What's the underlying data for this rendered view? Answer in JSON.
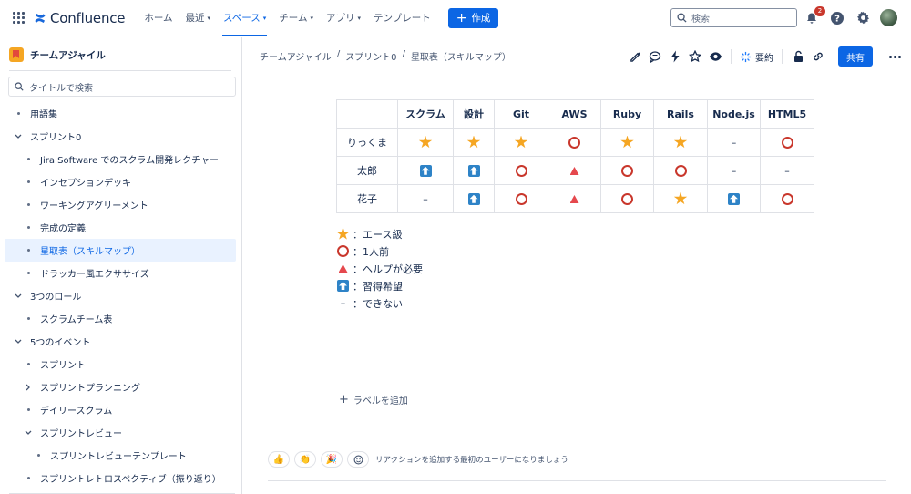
{
  "topnav": {
    "brand": "Confluence",
    "items": [
      {
        "label": "ホーム",
        "dropdown": false,
        "active": false
      },
      {
        "label": "最近",
        "dropdown": true,
        "active": false
      },
      {
        "label": "スペース",
        "dropdown": true,
        "active": true
      },
      {
        "label": "チーム",
        "dropdown": true,
        "active": false
      },
      {
        "label": "アプリ",
        "dropdown": true,
        "active": false
      },
      {
        "label": "テンプレート",
        "dropdown": false,
        "active": false
      }
    ],
    "create_label": "作成",
    "search_placeholder": "検索",
    "notification_count": "2"
  },
  "sidebar": {
    "space_name": "チームアジャイル",
    "search_placeholder": "タイトルで検索",
    "tree": [
      {
        "label": "用語集",
        "indent": 0,
        "marker": "bullet"
      },
      {
        "label": "スプリント0",
        "indent": 0,
        "marker": "expanded"
      },
      {
        "label": "Jira Software でのスクラム開発レクチャー",
        "indent": 1,
        "marker": "bullet"
      },
      {
        "label": "インセプションデッキ",
        "indent": 1,
        "marker": "bullet"
      },
      {
        "label": "ワーキングアグリーメント",
        "indent": 1,
        "marker": "bullet"
      },
      {
        "label": "完成の定義",
        "indent": 1,
        "marker": "bullet"
      },
      {
        "label": "星取表（スキルマップ）",
        "indent": 1,
        "marker": "bullet",
        "active": true
      },
      {
        "label": "ドラッカー風エクササイズ",
        "indent": 1,
        "marker": "bullet"
      },
      {
        "label": "3つのロール",
        "indent": 0,
        "marker": "expanded"
      },
      {
        "label": "スクラムチーム表",
        "indent": 1,
        "marker": "bullet"
      },
      {
        "label": "5つのイベント",
        "indent": 0,
        "marker": "expanded"
      },
      {
        "label": "スプリント",
        "indent": 1,
        "marker": "bullet"
      },
      {
        "label": "スプリントプランニング",
        "indent": 1,
        "marker": "collapsed"
      },
      {
        "label": "デイリースクラム",
        "indent": 1,
        "marker": "bullet"
      },
      {
        "label": "スプリントレビュー",
        "indent": 1,
        "marker": "expanded"
      },
      {
        "label": "スプリントレビューテンプレート",
        "indent": 2,
        "marker": "bullet"
      },
      {
        "label": "スプリントレトロスペクティブ（振り返り）",
        "indent": 1,
        "marker": "bullet"
      }
    ]
  },
  "breadcrumb": [
    "チームアジャイル",
    "スプリント0",
    "星取表（スキルマップ）"
  ],
  "page_actions": {
    "summary_label": "要約",
    "share_label": "共有"
  },
  "skill_table": {
    "headers": [
      "",
      "スクラム",
      "設計",
      "Git",
      "AWS",
      "Ruby",
      "Rails",
      "Node.js",
      "HTML5"
    ],
    "rows": [
      {
        "name": "りっくま",
        "cells": [
          "star",
          "star",
          "star",
          "circle",
          "star",
          "star",
          "dash",
          "circle"
        ]
      },
      {
        "name": "太郎",
        "cells": [
          "up",
          "up",
          "circle",
          "tri",
          "circle",
          "circle",
          "dash",
          "dash"
        ]
      },
      {
        "name": "花子",
        "cells": [
          "dash",
          "up",
          "circle",
          "tri",
          "circle",
          "star",
          "up",
          "circle"
        ]
      }
    ]
  },
  "legend": [
    {
      "symbol": "star",
      "text": "：エース級"
    },
    {
      "symbol": "circle",
      "text": "：1人前"
    },
    {
      "symbol": "tri",
      "text": "：ヘルプが必要"
    },
    {
      "symbol": "up",
      "text": "：習得希望"
    },
    {
      "symbol": "dash",
      "text": "：できない"
    }
  ],
  "add_label_text": "ラベルを追加",
  "reactions": {
    "buttons": [
      "👍",
      "👏",
      "🎉"
    ],
    "prompt": "リアクションを追加する最初のユーザーになりましょう"
  },
  "colors": {
    "accent": "#0c66e4",
    "star": "#f5a623",
    "circle": "#c9372c",
    "triangle": "#e5484d",
    "up_arrow": "#2e83c7"
  }
}
